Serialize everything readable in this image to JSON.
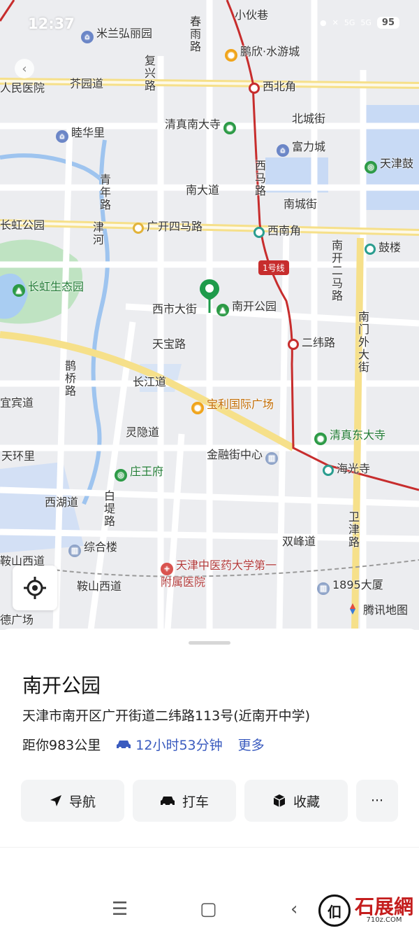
{
  "status": {
    "time": "12:37",
    "battery": "95",
    "net1": "5G",
    "net2": "5G"
  },
  "map": {
    "labels": {
      "mi_lan": "米兰弘丽园",
      "xiao_huo_xiang": "小伙巷",
      "chun_yu_lu": "春雨路",
      "peng_xin": "鹏欣·水游城",
      "fu_xing_lu": "复兴路",
      "jie_yuan_dao": "芥园道",
      "ren_min_yi_yuan": "人民医院",
      "xi_bei_jiao": "西北角",
      "bei_cheng_jie": "北城街",
      "qing_zhen_nan": "清真南大寺",
      "mu_hua_li": "睦华里",
      "fu_li_cheng": "富力城",
      "tian_jin_gu": "天津鼓",
      "xi_ma_lu": "西马路",
      "qing_nian_lu": "青年路",
      "nan_da_dao": "南大道",
      "nan_cheng_jie": "南城街",
      "chang_hong_gy": "长虹公园",
      "guang_kai_si": "广开四马路",
      "xi_nan_jiao": "西南角",
      "gu_lou": "鼓楼",
      "jin_he": "津河",
      "nan_kai_er": "南开二马路",
      "line1": "1号线",
      "chang_hong_st": "长虹生态园",
      "xi_shi_da_jie": "西市大街",
      "nan_kai_park": "南开公园",
      "er_wei_lu": "二纬路",
      "nan_men_wai": "南门外大街",
      "tian_bao_lu": "天宝路",
      "que_qiao_lu": "鹊桥路",
      "chang_jiang_dao": "长江道",
      "yi_bin_dao": "宜宾道",
      "bao_li": "宝利国际广场",
      "qing_zhen_dong": "清真东大寺",
      "ling_yin_dao": "灵隐道",
      "tian_huan_li": "天环里",
      "jin_rong_jie": "金融街中心",
      "hai_guang_si": "海光寺",
      "zhuang_wang_fu": "庄王府",
      "xi_hu_dao": "西湖道",
      "bai_di_lu": "白堤路",
      "wei_jin_lu": "卫津路",
      "zong_he_lou": "综合楼",
      "shuang_feng_dao": "双峰道",
      "an_shan_xi_l": "鞍山西道",
      "an_shan_xi_r": "鞍山西道",
      "hospital": "天津中医药大学第一附属医院",
      "sha_1895": "1895大厦",
      "de_guang_chang": "德广场"
    },
    "brand": "腾讯地图"
  },
  "place": {
    "title": "南开公园",
    "address": "天津市南开区广开街道二纬路113号(近南开中学)",
    "distance": "距你983公里",
    "drive_time": "12小时53分钟",
    "more": "更多"
  },
  "actions": {
    "navigate": "导航",
    "taxi": "打车",
    "favorite": "收藏",
    "more": "···"
  },
  "watermark": {
    "brand": "石展網",
    "domain": "710z.COM"
  }
}
